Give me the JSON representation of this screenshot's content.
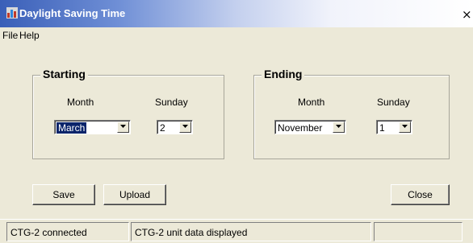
{
  "window": {
    "title": "Daylight Saving Time",
    "close_glyph": "×"
  },
  "menu": {
    "file": "File",
    "help": "Help"
  },
  "starting": {
    "title": "Starting",
    "month_label": "Month",
    "sunday_label": "Sunday",
    "month_value": "March",
    "sunday_value": "2"
  },
  "ending": {
    "title": "Ending",
    "month_label": "Month",
    "sunday_label": "Sunday",
    "month_value": "November",
    "sunday_value": "1"
  },
  "buttons": {
    "save": "Save",
    "upload": "Upload",
    "close": "Close"
  },
  "status": {
    "connection": "CTG-2 connected",
    "message": "CTG-2 unit data displayed",
    "extra": ""
  },
  "icons": {
    "app": "app-icon",
    "dropdown": "chevron-down-icon",
    "close": "close-icon"
  }
}
